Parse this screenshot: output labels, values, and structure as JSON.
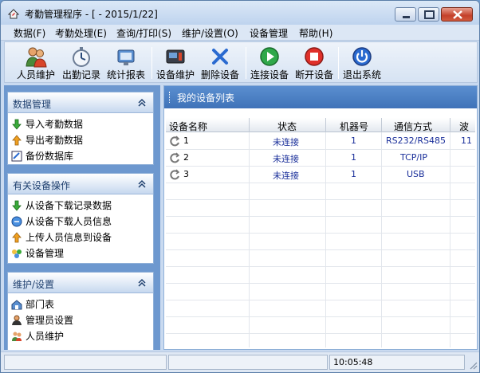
{
  "window": {
    "title": "考勤管理程序 - [ - 2015/1/22]"
  },
  "menu": [
    "数据(F)",
    "考勤处理(E)",
    "查询/打印(S)",
    "维护/设置(O)",
    "设备管理",
    "帮助(H)"
  ],
  "toolbar": {
    "staff": "人员维护",
    "attendance": "出勤记录",
    "report": "统计报表",
    "device_maint": "设备维护",
    "delete_device": "删除设备",
    "connect": "连接设备",
    "disconnect": "断开设备",
    "exit": "退出系统"
  },
  "sidebar": {
    "panel1": {
      "title": "数据管理",
      "items": [
        "导入考勤数据",
        "导出考勤数据",
        "备份数据库"
      ]
    },
    "panel2": {
      "title": "有关设备操作",
      "items": [
        "从设备下载记录数据",
        "从设备下载人员信息",
        "上传人员信息到设备",
        "设备管理"
      ]
    },
    "panel3": {
      "title": "维护/设置",
      "items": [
        "部门表",
        "管理员设置",
        "人员维护"
      ]
    }
  },
  "main": {
    "title": "我的设备列表",
    "columns": [
      "设备名称",
      "状态",
      "机器号",
      "通信方式",
      "波"
    ],
    "rows": [
      {
        "name": "1",
        "status": "未连接",
        "id": "1",
        "comm": "RS232/RS485",
        "baud": "11"
      },
      {
        "name": "2",
        "status": "未连接",
        "id": "1",
        "comm": "TCP/IP",
        "baud": ""
      },
      {
        "name": "3",
        "status": "未连接",
        "id": "1",
        "comm": "USB",
        "baud": ""
      }
    ]
  },
  "status": {
    "time": "10:05:48"
  }
}
